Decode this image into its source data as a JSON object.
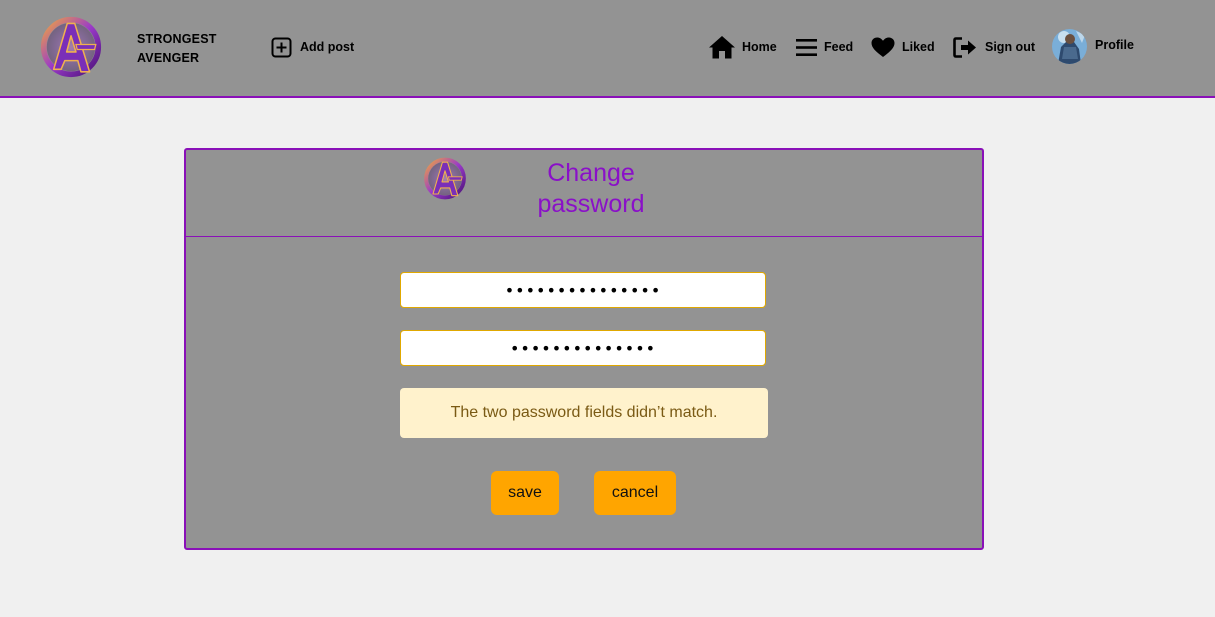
{
  "brand": {
    "line1": "STRONGEST",
    "line2": "AVENGER",
    "logo_icon": "avengers-logo-icon"
  },
  "nav": {
    "add_post": "Add post",
    "home": "Home",
    "feed": "Feed",
    "liked": "Liked",
    "sign_out": "Sign out",
    "profile": "Profile"
  },
  "form": {
    "title_line1": "Change",
    "title_line2": "password",
    "new_password": "•••••••••••••••",
    "confirm_password": "••••••••••••••",
    "error": "The two password fields didn’t match.",
    "save_label": "save",
    "cancel_label": "cancel"
  },
  "colors": {
    "accent": "#8a10b8",
    "button": "#ffa500",
    "alert_bg": "#fff2cc",
    "panel": "#939393"
  }
}
